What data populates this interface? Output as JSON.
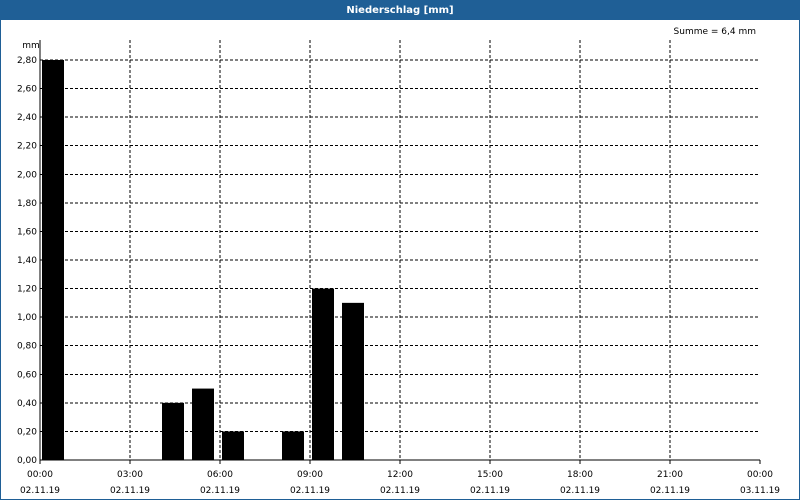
{
  "window": {
    "title": "Niederschlag [mm]"
  },
  "chart_data": {
    "type": "bar",
    "title": "Niederschlag [mm]",
    "ylabel": "mm",
    "annotation": "Summe = 6,4 mm",
    "ylim": [
      0,
      2.8
    ],
    "y_ticks": [
      "0,00",
      "0,20",
      "0,40",
      "0,60",
      "0,80",
      "1,00",
      "1,20",
      "1,40",
      "1,60",
      "1,80",
      "2,00",
      "2,20",
      "2,40",
      "2,60",
      "2,80"
    ],
    "xlim_hours": [
      0,
      24
    ],
    "x_ticks": [
      {
        "time": "00:00",
        "date": "02.11.19"
      },
      {
        "time": "03:00",
        "date": "02.11.19"
      },
      {
        "time": "06:00",
        "date": "02.11.19"
      },
      {
        "time": "09:00",
        "date": "02.11.19"
      },
      {
        "time": "12:00",
        "date": "02.11.19"
      },
      {
        "time": "15:00",
        "date": "02.11.19"
      },
      {
        "time": "18:00",
        "date": "02.11.19"
      },
      {
        "time": "21:00",
        "date": "02.11.19"
      },
      {
        "time": "00:00",
        "date": "03.11.19"
      }
    ],
    "series": [
      {
        "values": [
          {
            "hour": 0,
            "value": 2.8
          },
          {
            "hour": 4,
            "value": 0.4
          },
          {
            "hour": 5,
            "value": 0.5
          },
          {
            "hour": 6,
            "value": 0.2
          },
          {
            "hour": 8,
            "value": 0.2
          },
          {
            "hour": 9,
            "value": 1.2
          },
          {
            "hour": 10,
            "value": 1.1
          }
        ]
      }
    ],
    "grid": true,
    "bar_color": "#000000"
  }
}
